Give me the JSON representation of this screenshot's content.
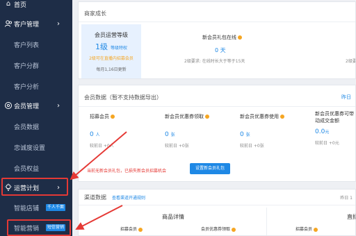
{
  "sidebar": {
    "home": "首页",
    "customer_mgmt": "客户管理",
    "customer_list": "客户列表",
    "customer_group": "客户分群",
    "customer_analysis": "客户分析",
    "member_mgmt": "会员管理",
    "member_data": "会员数据",
    "loyalty_settings": "忠诚度设置",
    "member_rights": "会员权益",
    "operation_plan": "运营计划",
    "smart_shopping": "智能店铺",
    "smart_shopping_tag": "千人千面",
    "smart_marketing": "智能营销",
    "smart_marketing_tag": "短信营销",
    "highlight_color": "#e53935"
  },
  "growth": {
    "title": "商家成长",
    "level_title": "会员运营等级",
    "level_value": "1级",
    "level_detail": "等级特权",
    "level_note": "2级可在直播内招募会员",
    "update": "每月1,16日更新",
    "task_name": "新会员礼包在线",
    "task_value": "0 天",
    "task_requirement": "2级要求: 在线时长大于等于15天",
    "task_requirement_right": "2级要"
  },
  "member_data": {
    "title": "会员数据（暂不支持数据导出）",
    "link": "昨日",
    "stats": [
      {
        "label": "招募会员",
        "value": "0",
        "unit": "人",
        "compare": "较前日 +0人"
      },
      {
        "label": "新会员优惠券领取",
        "value": "0",
        "unit": "张",
        "compare": "较前日 +0张"
      },
      {
        "label": "新会员优惠券使用",
        "value": "0",
        "unit": "张",
        "compare": "较前日 +0张"
      },
      {
        "label": "新会员优惠券可带动成交金额",
        "value": "0.0",
        "unit": "元",
        "compare": "较前日 +0元"
      }
    ],
    "warning": "当前无新会员礼包，已损失新会员招募机会",
    "button": "设置新会员礼包"
  },
  "channel": {
    "title": "渠道数据",
    "link": "查看渠道开通规则",
    "right": "昨日 1",
    "head_left": "商品详情",
    "head_right": "直播",
    "sub1": "招募会员",
    "sub2": "会员优惠券领取",
    "sub3": "招募会员"
  },
  "accent": "#1e88e5"
}
